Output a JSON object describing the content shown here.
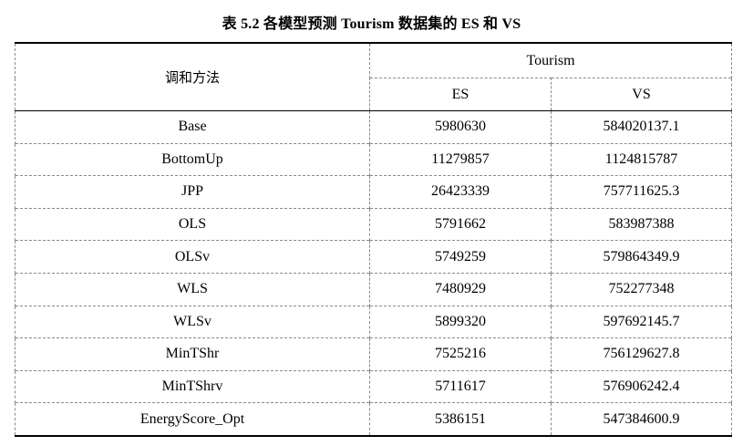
{
  "caption": "表  5.2  各模型预测 Tourism 数据集的 ES 和 VS",
  "header": {
    "method": "调和方法",
    "dataset": "Tourism",
    "es": "ES",
    "vs": "VS"
  },
  "rows": [
    {
      "method": "Base",
      "es": "5980630",
      "vs": "584020137.1"
    },
    {
      "method": "BottomUp",
      "es": "11279857",
      "vs": "1124815787"
    },
    {
      "method": "JPP",
      "es": "26423339",
      "vs": "757711625.3"
    },
    {
      "method": "OLS",
      "es": "5791662",
      "vs": "583987388"
    },
    {
      "method": "OLSv",
      "es": "5749259",
      "vs": "579864349.9"
    },
    {
      "method": "WLS",
      "es": "7480929",
      "vs": "752277348"
    },
    {
      "method": "WLSv",
      "es": "5899320",
      "vs": "597692145.7"
    },
    {
      "method": "MinTShr",
      "es": "7525216",
      "vs": "756129627.8"
    },
    {
      "method": "MinTShrv",
      "es": "5711617",
      "vs": "576906242.4"
    },
    {
      "method": "EnergyScore_Opt",
      "es": "5386151",
      "vs": "547384600.9"
    }
  ]
}
